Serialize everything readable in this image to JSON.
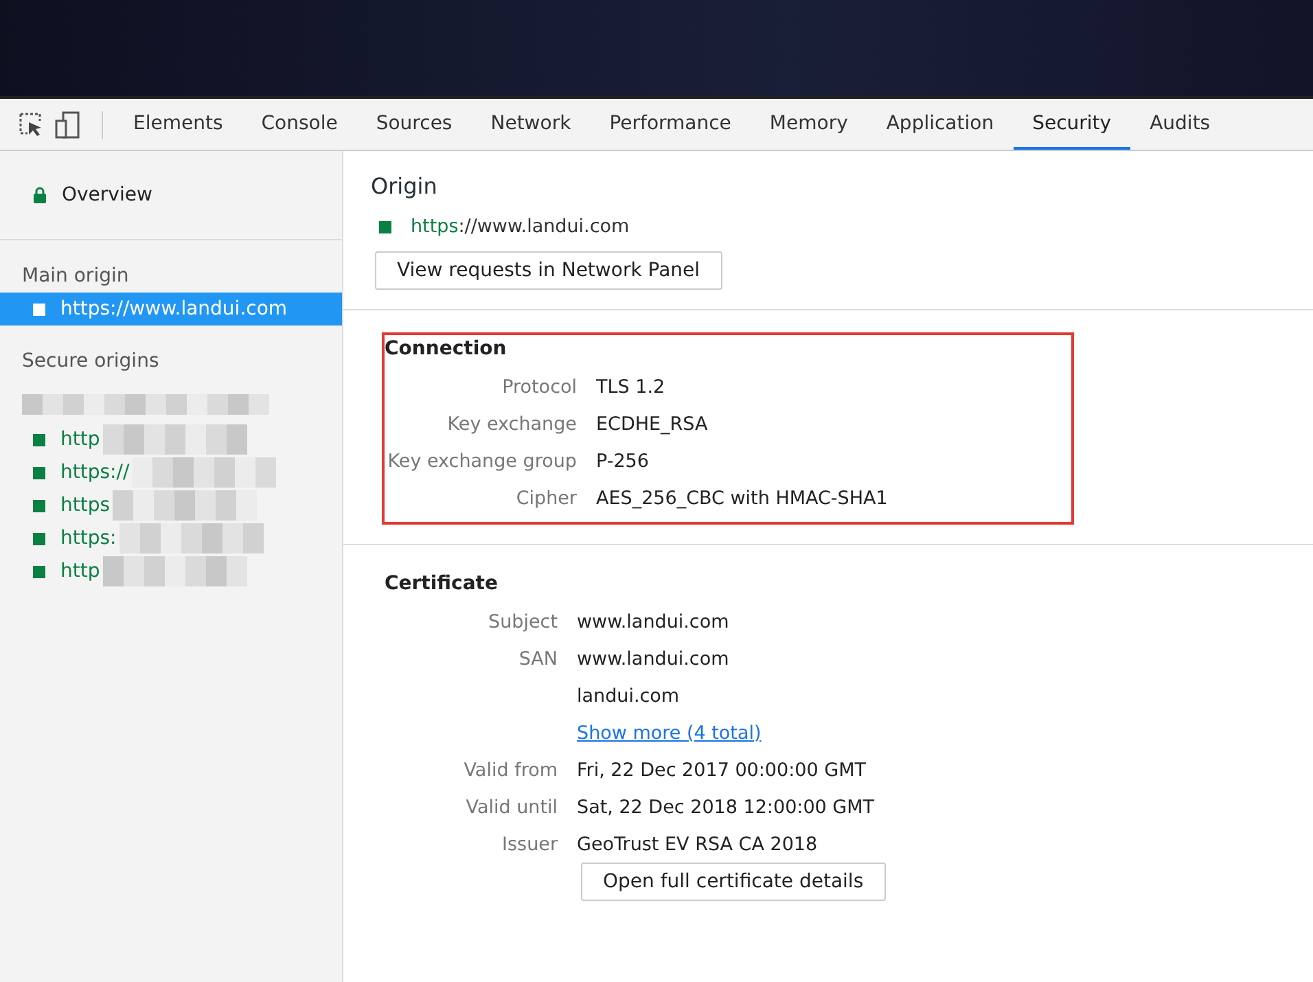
{
  "tabs": [
    {
      "label": "Elements",
      "selected": false
    },
    {
      "label": "Console",
      "selected": false
    },
    {
      "label": "Sources",
      "selected": false
    },
    {
      "label": "Network",
      "selected": false
    },
    {
      "label": "Performance",
      "selected": false
    },
    {
      "label": "Memory",
      "selected": false
    },
    {
      "label": "Application",
      "selected": false
    },
    {
      "label": "Security",
      "selected": true
    },
    {
      "label": "Audits",
      "selected": false
    }
  ],
  "sidebar": {
    "overview": {
      "label": "Overview",
      "selected": false
    },
    "main_origin": {
      "heading": "Main origin",
      "items": [
        {
          "label": "https://www.landui.com",
          "selected": true
        }
      ]
    },
    "secure_origins": {
      "heading": "Secure origins",
      "items": [
        {
          "label": "http",
          "selected": false
        },
        {
          "label": "https://",
          "selected": false
        },
        {
          "label": "https",
          "selected": false
        },
        {
          "label": "https:",
          "selected": false
        },
        {
          "label": "http",
          "selected": false
        }
      ]
    }
  },
  "origin": {
    "title": "Origin",
    "scheme": "https",
    "rest": "://www.landui.com",
    "button": "View requests in Network Panel"
  },
  "connection": {
    "title": "Connection",
    "highlighted": true,
    "rows": [
      {
        "label": "Protocol",
        "value": "TLS 1.2"
      },
      {
        "label": "Key exchange",
        "value": "ECDHE_RSA"
      },
      {
        "label": "Key exchange group",
        "value": "P-256"
      },
      {
        "label": "Cipher",
        "value": "AES_256_CBC with HMAC-SHA1"
      }
    ]
  },
  "certificate": {
    "title": "Certificate",
    "rows": [
      {
        "label": "Subject",
        "value": "www.landui.com",
        "kind": "text"
      },
      {
        "label": "SAN",
        "value": "www.landui.com",
        "kind": "text"
      },
      {
        "value": "landui.com",
        "kind": "text"
      },
      {
        "value": "Show more (4 total)",
        "kind": "link"
      },
      {
        "label": "Valid from",
        "value": "Fri, 22 Dec 2017 00:00:00 GMT",
        "kind": "text"
      },
      {
        "label": "Valid until",
        "value": "Sat, 22 Dec 2018 12:00:00 GMT",
        "kind": "text"
      },
      {
        "label": "Issuer",
        "value": "GeoTrust EV RSA CA 2018",
        "kind": "text"
      }
    ],
    "button": "Open full certificate details"
  }
}
